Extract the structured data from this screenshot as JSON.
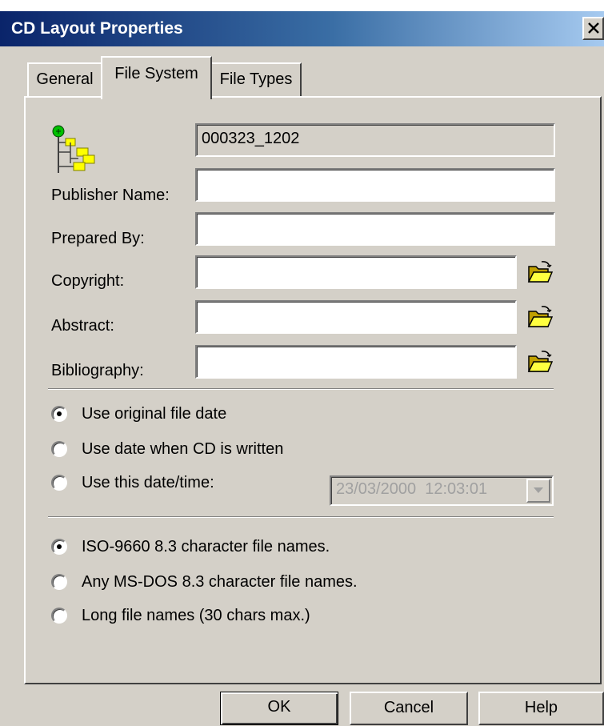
{
  "window": {
    "title": "CD Layout Properties"
  },
  "tabs": [
    {
      "label": "General",
      "selected": false
    },
    {
      "label": "File System",
      "selected": true
    },
    {
      "label": "File Types",
      "selected": false
    }
  ],
  "volume": {
    "icon": "folder-tree-icon",
    "name_value": "000323_1202"
  },
  "fields": {
    "publisher": {
      "label": "Publisher Name:",
      "value": ""
    },
    "prepared_by": {
      "label": "Prepared By:",
      "value": ""
    },
    "copyright": {
      "label": "Copyright:",
      "value": ""
    },
    "abstract": {
      "label": "Abstract:",
      "value": ""
    },
    "bibliography": {
      "label": "Bibliography:",
      "value": ""
    }
  },
  "date_options": {
    "selected": 0,
    "items": [
      {
        "label": "Use original file date"
      },
      {
        "label": "Use date when CD is written"
      },
      {
        "label": "Use this date/time:"
      }
    ],
    "datetime_value": "23/03/2000  12:03:01"
  },
  "filename_options": {
    "selected": 0,
    "items": [
      {
        "label": "ISO-9660 8.3 character file names."
      },
      {
        "label": "Any MS-DOS 8.3 character file names."
      },
      {
        "label": "Long file names (30 chars max.)"
      }
    ]
  },
  "buttons": {
    "ok": "OK",
    "cancel": "Cancel",
    "help": "Help"
  },
  "colors": {
    "face": "#d4d0c8",
    "title_start": "#0a246a",
    "title_end": "#a6caf0",
    "folder_icon": "#ffff00"
  }
}
